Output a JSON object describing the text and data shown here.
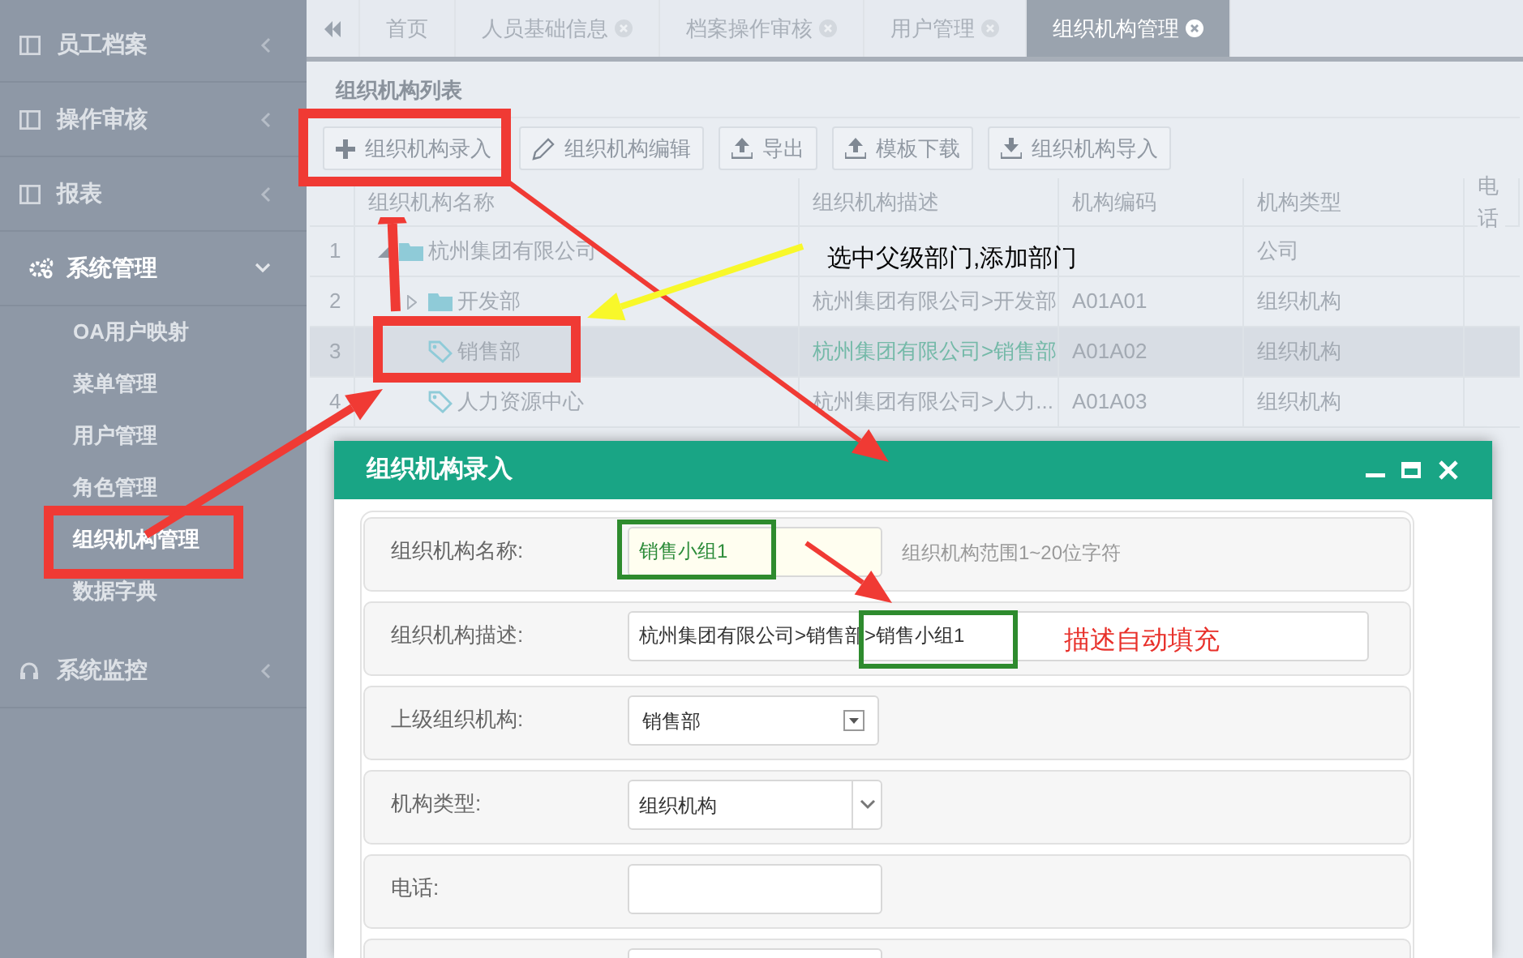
{
  "sidebar": {
    "items": [
      {
        "label": "员工档案",
        "expanded": false
      },
      {
        "label": "操作审核",
        "expanded": false
      },
      {
        "label": "报表",
        "expanded": false
      },
      {
        "label": "系统管理",
        "expanded": true,
        "children": [
          {
            "label": "OA用户映射",
            "selected": false
          },
          {
            "label": "菜单管理",
            "selected": false
          },
          {
            "label": "用户管理",
            "selected": false
          },
          {
            "label": "角色管理",
            "selected": false
          },
          {
            "label": "组织机构管理",
            "selected": true
          },
          {
            "label": "数据字典",
            "selected": false
          }
        ]
      },
      {
        "label": "系统监控",
        "expanded": false
      }
    ]
  },
  "tabs": [
    {
      "label": "首页",
      "closable": false,
      "selected": false
    },
    {
      "label": "人员基础信息",
      "closable": true,
      "selected": false
    },
    {
      "label": "档案操作审核",
      "closable": true,
      "selected": false
    },
    {
      "label": "用户管理",
      "closable": true,
      "selected": false
    },
    {
      "label": "组织机构管理",
      "closable": true,
      "selected": true
    }
  ],
  "panel": {
    "title": "组织机构列表",
    "toolbar": [
      {
        "label": "组织机构录入"
      },
      {
        "label": "组织机构编辑"
      },
      {
        "label": "导出"
      },
      {
        "label": "模板下载"
      },
      {
        "label": "组织机构导入"
      }
    ],
    "table": {
      "columns": [
        "组织机构名称",
        "组织机构描述",
        "机构编码",
        "机构类型",
        "电话"
      ],
      "rows": [
        {
          "number": "1",
          "name": "杭州集团有限公司",
          "kind": "folder",
          "expanded": true,
          "selected": false,
          "type": "公司",
          "children": [
            {
              "number": "2",
              "name": "开发部",
              "kind": "folder",
              "expanded": false,
              "selected": false,
              "description": "杭州集团有限公司>开发部",
              "code": "A01A01",
              "type": "组织机构"
            },
            {
              "number": "3",
              "name": "销售部",
              "kind": "leaf",
              "selected": true,
              "description": "杭州集团有限公司>销售部",
              "code": "A01A02",
              "type": "组织机构"
            },
            {
              "number": "4",
              "name": "人力资源中心",
              "kind": "leaf",
              "selected": false,
              "description": "杭州集团有限公司>人力...",
              "code": "A01A03",
              "type": "组织机构"
            }
          ]
        }
      ]
    }
  },
  "dialog": {
    "title": "组织机构录入",
    "fields": [
      {
        "label": "组织机构名称:",
        "kind": "text",
        "value": "销售小组1",
        "focused": true,
        "hint": "组织机构范围1~20位字符"
      },
      {
        "label": "组织机构描述:",
        "kind": "wide",
        "value": "杭州集团有限公司>销售部>销售小组1",
        "focused": false
      },
      {
        "label": "上级组织机构:",
        "kind": "combo",
        "value": "销售部",
        "focused": false
      },
      {
        "label": "机构类型:",
        "kind": "select",
        "value": "组织机构",
        "focused": false
      },
      {
        "label": "电话:",
        "kind": "text",
        "focused": false
      },
      {
        "kind": "text",
        "focused": false
      }
    ]
  },
  "annotations": [
    {
      "text": "选中父级部门,添加部门",
      "color": "#000000"
    },
    {
      "text": "描述自动填充",
      "color": "#e8302a"
    }
  ]
}
